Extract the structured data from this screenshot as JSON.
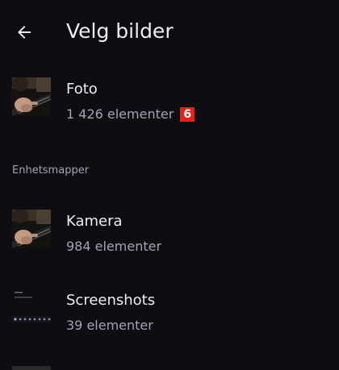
{
  "header": {
    "title": "Velg bilder",
    "back_icon": "arrow-back-icon"
  },
  "albums_top": [
    {
      "title": "Foto",
      "count": "1 426 elementer",
      "badge": "6",
      "thumb_icon": "guitar-photo-thumbnail",
      "badge_color": "#e0231b"
    }
  ],
  "section": {
    "title": "Enhetsmapper"
  },
  "folders": [
    {
      "title": "Kamera",
      "count": "984 elementer",
      "thumb_icon": "guitar-photo-thumbnail"
    },
    {
      "title": "Screenshots",
      "count": "39 elementer",
      "thumb_icon": "screenshot-thumbnail"
    }
  ],
  "colors": {
    "background": "#0d0d14",
    "text_primary": "#ececf2",
    "text_secondary": "#a4a4b0",
    "badge": "#e0231b"
  }
}
